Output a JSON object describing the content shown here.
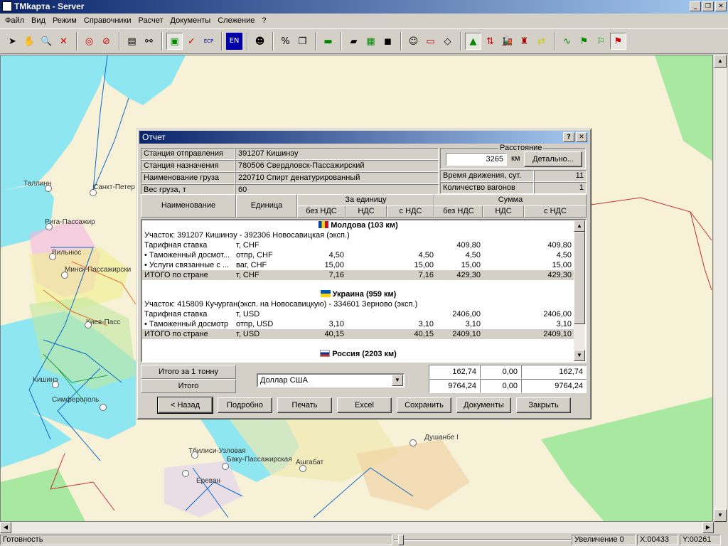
{
  "app": {
    "title": "TMkарта - Server"
  },
  "menu": [
    "Файл",
    "Вид",
    "Режим",
    "Справочники",
    "Расчет",
    "Документы",
    "Слежение",
    "?"
  ],
  "colors": {
    "title_start": "#0a246a",
    "title_end": "#a6caf0",
    "sea": "#8ee6f0",
    "land": "#f7f1d8"
  },
  "toolbar_icons": [
    "arrow-icon",
    "hand-icon",
    "zoom-icon",
    "close-x-icon",
    "target-icon",
    "compass-icon",
    "properties-icon",
    "binoculars-icon",
    "route-icon",
    "check-route-icon",
    "ecp-route-icon",
    "language-icon",
    "agent-icon",
    "percent-icon",
    "copy-icon",
    "money-icon",
    "book-icon",
    "books-icon",
    "box-icon",
    "people-icon",
    "wagon-icon",
    "document-icon",
    "pyramid-icon",
    "updown-icon",
    "locomotive-icon",
    "tower-icon",
    "exchange-icon",
    "chart-icon",
    "route-flag-icon",
    "route-flag2-icon",
    "route-flag3-icon"
  ],
  "toolbar_labels": {
    "en": "EN",
    "percent": "%",
    "ecp": "ECP"
  },
  "cities": [
    "Таллинн",
    "Санкт-Петер",
    "Рига-Пассажир",
    "Вильнюс",
    "Минск-Пассажирски",
    "Киев-Пасс",
    "Кишинэ",
    "Симферополь",
    "Тбилиси-Узловая",
    "Баку-Пассажирская",
    "Ашгабат",
    "Ереван",
    "Душанбе I"
  ],
  "dialog": {
    "title": "Отчет",
    "info": [
      {
        "label": "Станция отправления",
        "value": "391207  Кишинэу"
      },
      {
        "label": "Станция назначения",
        "value": "780506  Свердловск-Пассажирский"
      },
      {
        "label": "Наименование груза",
        "value": "220710 Спирт денатурированный"
      },
      {
        "label": "Вес груза, т",
        "value": "60"
      }
    ],
    "distance": {
      "label": "Расстояние",
      "value": "3265",
      "unit": "км",
      "button": "Детально..."
    },
    "travel_time": {
      "label": "Время движения, сут.",
      "value": "11"
    },
    "wagons": {
      "label": "Количество вагонов",
      "value": "1"
    },
    "headers": {
      "name": "Наименование",
      "unit": "Единица",
      "per_unit": "За единицу",
      "sum": "Сумма",
      "no_vat": "без НДС",
      "vat": "НДС",
      "with_vat": "с НДС"
    },
    "countries": [
      {
        "name": "Молдова (103 км)",
        "flag": [
          "#0046ae",
          "#ffd200",
          "#cc092f"
        ],
        "section": "Участок:  391207  Кишинэу -  392306  Новосавицкая (эксп.)",
        "rows": [
          {
            "name": "Тарифная ставка",
            "unit": "т, CHF",
            "p1": "",
            "p2": "",
            "p3": "",
            "s1": "409,80",
            "s2": "",
            "s3": "409,80"
          },
          {
            "name": "• Таможенный досмот...",
            "unit": "отпр, CHF",
            "p1": "4,50",
            "p2": "",
            "p3": "4,50",
            "s1": "4,50",
            "s2": "",
            "s3": "4,50"
          },
          {
            "name": "• Услуги связанные с ...",
            "unit": "ваг, CHF",
            "p1": "15,00",
            "p2": "",
            "p3": "15,00",
            "s1": "15,00",
            "s2": "",
            "s3": "15,00"
          },
          {
            "name": "ИТОГО по стране",
            "unit": "т, CHF",
            "p1": "7,16",
            "p2": "",
            "p3": "7,16",
            "s1": "429,30",
            "s2": "",
            "s3": "429,30"
          }
        ]
      },
      {
        "name": "Украина (959 км)",
        "flag": [
          "#0057b7",
          "#ffd700"
        ],
        "section": "Участок:  415809  Кучурган(эксп. на Новосавицкую) -  334601  Зерново (эксп.)",
        "rows": [
          {
            "name": "Тарифная ставка",
            "unit": "т, USD",
            "p1": "",
            "p2": "",
            "p3": "",
            "s1": "2406,00",
            "s2": "",
            "s3": "2406,00"
          },
          {
            "name": "• Таможенный досмотр",
            "unit": "отпр, USD",
            "p1": "3,10",
            "p2": "",
            "p3": "3,10",
            "s1": "3,10",
            "s2": "",
            "s3": "3,10"
          },
          {
            "name": "ИТОГО по стране",
            "unit": "т, USD",
            "p1": "40,15",
            "p2": "",
            "p3": "40,15",
            "s1": "2409,10",
            "s2": "",
            "s3": "2409,10"
          }
        ]
      },
      {
        "name": "Россия (2203 км)",
        "flag": [
          "#ffffff",
          "#0039a6",
          "#d52b1e"
        ],
        "section": "",
        "rows": []
      }
    ],
    "totals": {
      "per_ton_label": "Итого за 1 тонну",
      "total_label": "Итого",
      "currency": "Доллар США",
      "per_ton": [
        "162,74",
        "0,00",
        "162,74"
      ],
      "total": [
        "9764,24",
        "0,00",
        "9764,24"
      ]
    },
    "buttons": [
      "< Назад",
      "Подробно",
      "Печать",
      "Excel",
      "Сохранить",
      "Документы",
      "Закрыть"
    ]
  },
  "status": {
    "ready": "Готовность",
    "zoom": "Увеличение 0",
    "x": "X:00433",
    "y": "Y:00261"
  }
}
